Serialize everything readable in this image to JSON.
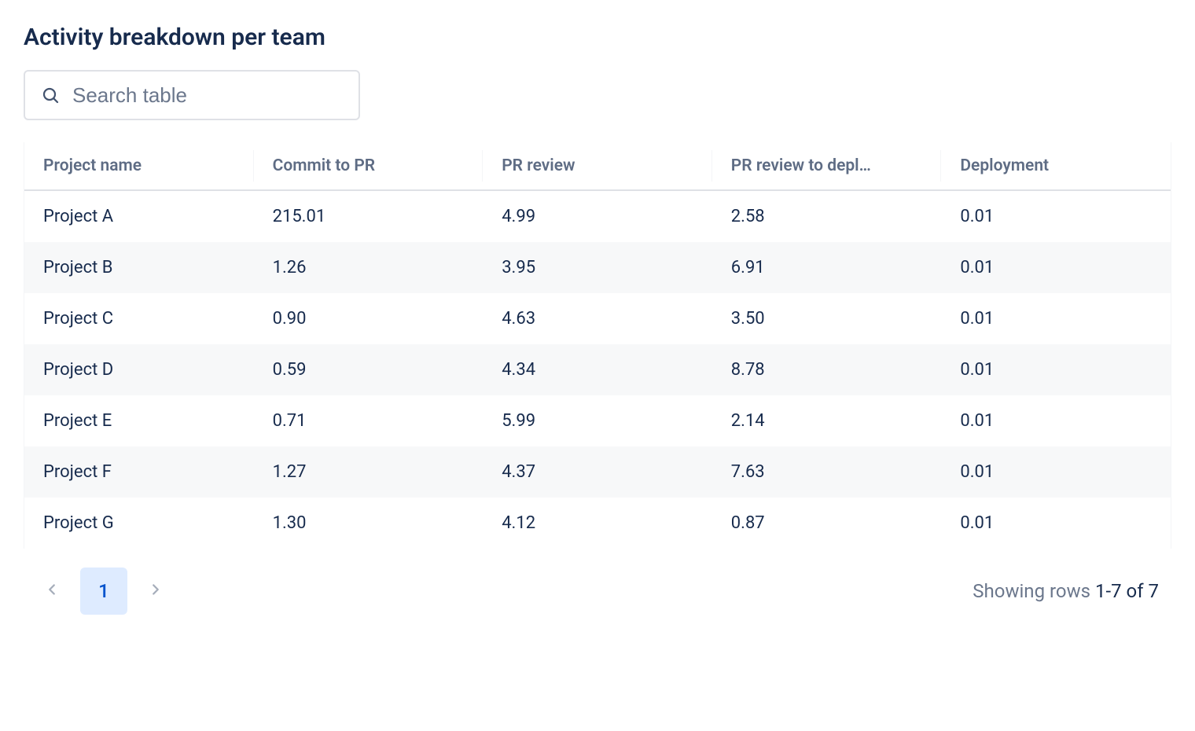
{
  "title": "Activity breakdown per team",
  "search": {
    "placeholder": "Search table",
    "value": ""
  },
  "table": {
    "headers": [
      "Project name",
      "Commit to PR",
      "PR review",
      "PR review to depl…",
      "Deployment"
    ],
    "rows": [
      {
        "cells": [
          "Project A",
          "215.01",
          "4.99",
          "2.58",
          "0.01"
        ]
      },
      {
        "cells": [
          "Project B",
          "1.26",
          "3.95",
          "6.91",
          "0.01"
        ]
      },
      {
        "cells": [
          "Project C",
          "0.90",
          "4.63",
          "3.50",
          "0.01"
        ]
      },
      {
        "cells": [
          "Project D",
          "0.59",
          "4.34",
          "8.78",
          "0.01"
        ]
      },
      {
        "cells": [
          "Project E",
          "0.71",
          "5.99",
          "2.14",
          "0.01"
        ]
      },
      {
        "cells": [
          "Project F",
          "1.27",
          "4.37",
          "7.63",
          "0.01"
        ]
      },
      {
        "cells": [
          "Project G",
          "1.30",
          "4.12",
          "0.87",
          "0.01"
        ]
      }
    ]
  },
  "pagination": {
    "current_page": "1",
    "rows_label_prefix": "Showing rows ",
    "rows_range": "1-7 of 7"
  }
}
